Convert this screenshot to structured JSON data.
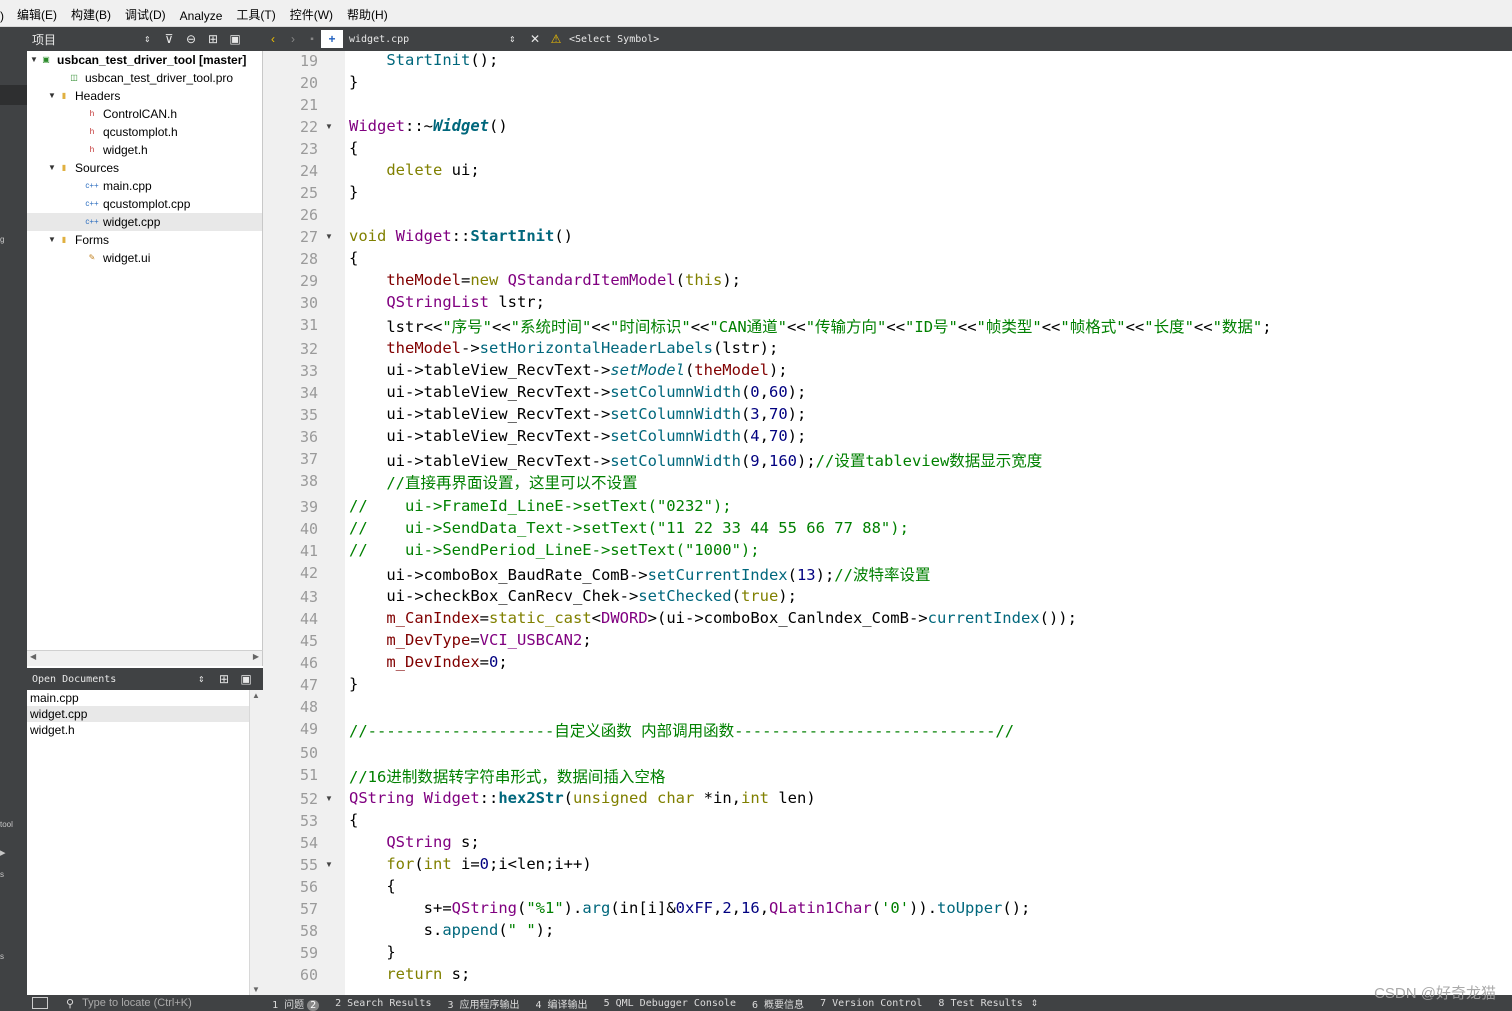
{
  "menu": [
    "编辑(E)",
    "构建(B)",
    "调试(D)",
    "Analyze",
    "工具(T)",
    "控件(W)",
    "帮助(H)"
  ],
  "sidebar_fragments": [
    ")",
    "tool",
    "s",
    "g",
    "s"
  ],
  "project_toolbar": {
    "selector": "项目"
  },
  "editor_toolbar": {
    "filename": "widget.cpp",
    "symbol": "<Select Symbol>"
  },
  "tree": {
    "root": "usbcan_test_driver_tool [master]",
    "pro_file": "usbcan_test_driver_tool.pro",
    "headers_label": "Headers",
    "headers": [
      "ControlCAN.h",
      "qcustomplot.h",
      "widget.h"
    ],
    "sources_label": "Sources",
    "sources": [
      "main.cpp",
      "qcustomplot.cpp",
      "widget.cpp"
    ],
    "forms_label": "Forms",
    "forms": [
      "widget.ui"
    ]
  },
  "open_documents": {
    "title": "Open Documents",
    "items": [
      "main.cpp",
      "widget.cpp",
      "widget.h"
    ],
    "selected": "widget.cpp"
  },
  "line_numbers": [
    19,
    20,
    21,
    22,
    23,
    24,
    25,
    26,
    27,
    28,
    29,
    30,
    31,
    32,
    33,
    34,
    35,
    36,
    37,
    38,
    39,
    40,
    41,
    42,
    43,
    44,
    45,
    46,
    47,
    48,
    49,
    50,
    51,
    52,
    53,
    54,
    55,
    56,
    57,
    58,
    59,
    60
  ],
  "fold_markers": [
    22,
    27,
    52,
    55
  ],
  "code_lines": [
    "    StartInit();",
    "}",
    "",
    "Widget::~Widget()",
    "{",
    "    delete ui;",
    "}",
    "",
    "void Widget::StartInit()",
    "{",
    "    theModel=new QStandardItemModel(this);",
    "    QStringList lstr;",
    "    lstr<<\"序号\"<<\"系统时间\"<<\"时间标识\"<<\"CAN通道\"<<\"传输方向\"<<\"ID号\"<<\"帧类型\"<<\"帧格式\"<<\"长度\"<<\"数据\";",
    "    theModel->setHorizontalHeaderLabels(lstr);",
    "    ui->tableView_RecvText->setModel(theModel);",
    "    ui->tableView_RecvText->setColumnWidth(0,60);",
    "    ui->tableView_RecvText->setColumnWidth(3,70);",
    "    ui->tableView_RecvText->setColumnWidth(4,70);",
    "    ui->tableView_RecvText->setColumnWidth(9,160);//设置tableview数据显示宽度",
    "    //直接再界面设置，这里可以不设置",
    "//    ui->FrameId_LineE->setText(\"0232\");",
    "//    ui->SendData_Text->setText(\"11 22 33 44 55 66 77 88\");",
    "//    ui->SendPeriod_LineE->setText(\"1000\");",
    "    ui->comboBox_BaudRate_ComB->setCurrentIndex(13);//波特率设置",
    "    ui->checkBox_CanRecv_Chek->setChecked(true);",
    "    m_CanIndex=static_cast<DWORD>(ui->comboBox_Canlndex_ComB->currentIndex());",
    "    m_DevType=VCI_USBCAN2;",
    "    m_DevIndex=0;",
    "}",
    "",
    "//--------------------自定义函数 内部调用函数----------------------------//",
    "",
    "//16进制数据转字符串形式，数据间插入空格",
    "QString Widget::hex2Str(unsigned char *in,int len)",
    "{",
    "    QString s;",
    "    for(int i=0;i<len;i++)",
    "    {",
    "        s+=QString(\"%1\").arg(in[i]&0xFF,2,16,QLatin1Char('0')).toUpper();",
    "        s.append(\" \");",
    "    }",
    "    return s;"
  ],
  "bottom_bar": {
    "locator_placeholder": "Type to locate (Ctrl+K)",
    "issues_badge": "2",
    "tabs": [
      "1 问题",
      "2 Search Results",
      "3 应用程序输出",
      "4 编译输出",
      "5 QML Debugger Console",
      "6 概要信息",
      "7 Version Control",
      "8 Test Results"
    ]
  },
  "watermark": "CSDN @好奇龙猫",
  "colors": {
    "keyword": "#808000",
    "function": "#00677c",
    "type": "#800080",
    "string": "#008000",
    "comment": "#008000",
    "number": "#000080",
    "panel": "#404244"
  }
}
